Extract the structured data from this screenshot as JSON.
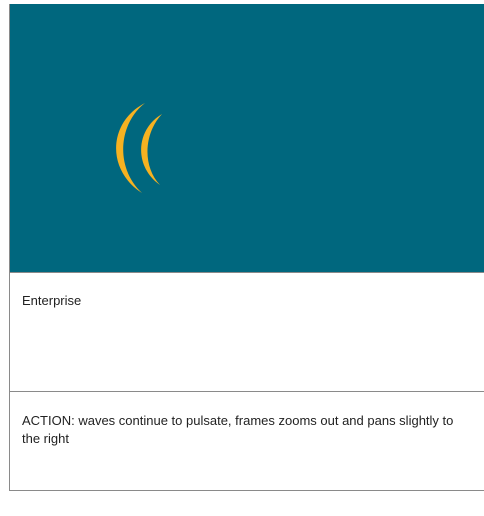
{
  "panel": {
    "background_color": "#00677e",
    "wave_color": "#f6b221",
    "wave_icon": "sound-waves-icon"
  },
  "caption": {
    "text": "Enterprise"
  },
  "action": {
    "text": "ACTION: waves continue to pulsate, frames zooms out and pans slightly to the right"
  }
}
